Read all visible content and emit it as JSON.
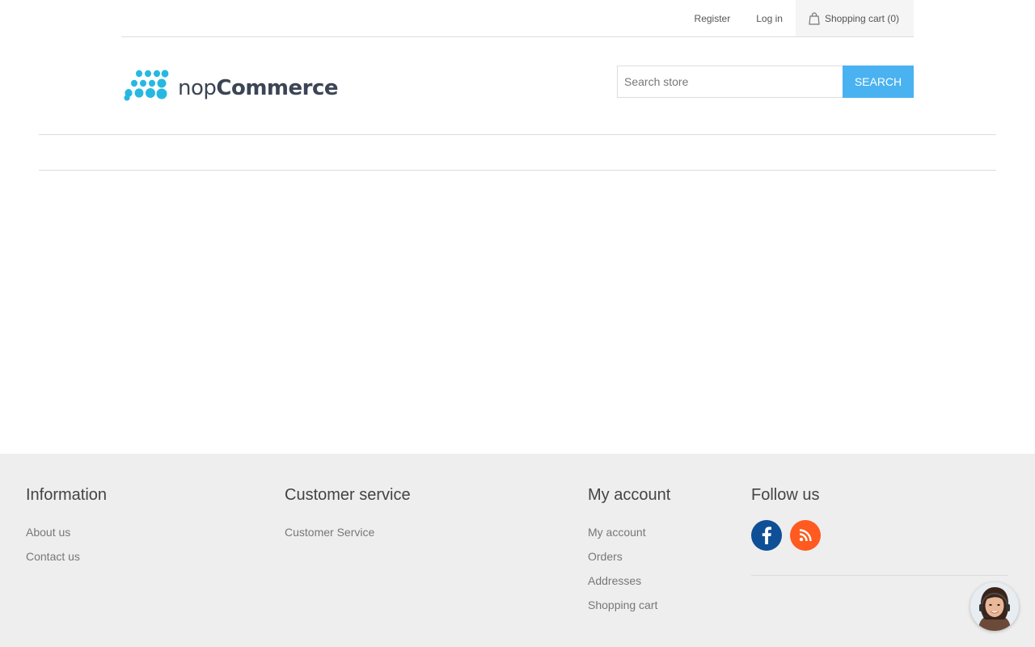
{
  "header": {
    "links": {
      "register": "Register",
      "login": "Log in",
      "cart": "Shopping cart (0)"
    },
    "logo": {
      "nop": "nop",
      "commerce": "Commerce"
    },
    "search": {
      "placeholder": "Search store",
      "button": "Search"
    }
  },
  "footer": {
    "information": {
      "title": "Information",
      "items": [
        "About us",
        "Contact us"
      ]
    },
    "customer_service": {
      "title": "Customer service",
      "items": [
        "Customer Service"
      ]
    },
    "my_account": {
      "title": "My account",
      "items": [
        "My account",
        "Orders",
        "Addresses",
        "Shopping cart"
      ]
    },
    "follow_us": {
      "title": "Follow us",
      "icons": [
        "facebook-icon",
        "rss-icon"
      ]
    }
  },
  "colors": {
    "accent": "#4ab2f1",
    "logo_dots": "#27b8e1",
    "facebook": "#0f4f96",
    "rss": "#ff5a1f",
    "footer_bg": "#eeeeee"
  }
}
